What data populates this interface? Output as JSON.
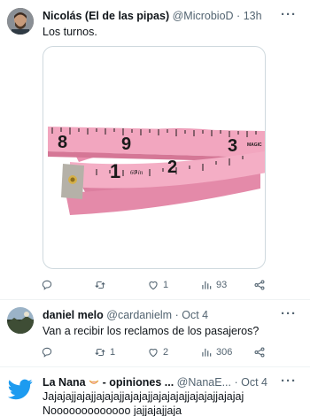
{
  "post1": {
    "display_name": "Nicolás (El de las pipas)",
    "handle": "@MicrobioD",
    "time": "13h",
    "text": "Los turnos.",
    "image_alt_icon": "pink-measuring-tape",
    "tape_numbers": [
      "8",
      "9",
      "2",
      "3",
      "1",
      "60 in",
      "MAGIC"
    ],
    "actions": {
      "reply": "",
      "retweet": "",
      "like": "1",
      "views": "93"
    }
  },
  "post2": {
    "display_name": "daniel melo",
    "handle": "@cardanielm",
    "time": "Oct 4",
    "text": "Van a recibir los reclamos de los pasajeros?",
    "actions": {
      "reply": "",
      "retweet": "1",
      "like": "2",
      "views": "306"
    }
  },
  "post3": {
    "display_name": "La Nana",
    "name_suffix": "- opiniones ...",
    "handle": "@NanaE...",
    "time": "Oct 4",
    "text_line1": "Jajajajjajajjajajajjajajajjajajajajjajajajjajajaj",
    "text_line2": "Nooooooooooooo jajjajajjaja",
    "avatar_icon": "twitter-bird-icon"
  },
  "colors": {
    "text": "#0f1419",
    "muted": "#536471",
    "divider": "#eff3f4",
    "tape_pink": "#f2a6bf",
    "twitter_blue": "#1d9bf0"
  },
  "separator": "·"
}
